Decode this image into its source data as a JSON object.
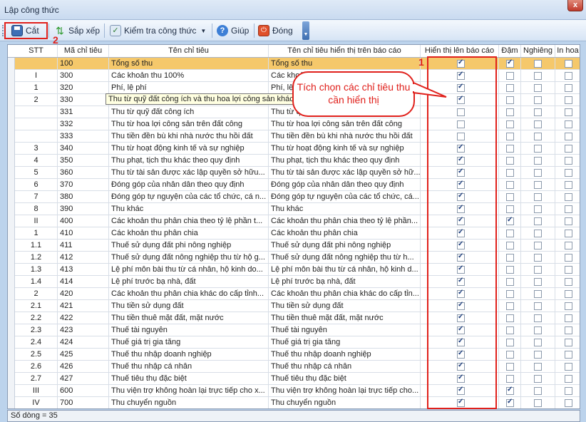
{
  "window": {
    "title": "Lập công thức",
    "close_glyph": "x"
  },
  "toolbar": {
    "cut_label": "Cắt",
    "sort_label": "Sắp xếp",
    "check_label": "Kiểm tra công thức",
    "help_label": "Giúp",
    "close_label": "Đóng"
  },
  "annotations": {
    "marker_1": "1",
    "marker_2": "2",
    "callout": "Tích chọn các chỉ tiêu thu cần hiển thị"
  },
  "tooltip": {
    "text": "Thu từ quỹ đất công ích và thu hoa lợi công sản khác đất công"
  },
  "columns": {
    "stt": "STT",
    "code": "Mã chỉ tiêu",
    "name": "Tên chỉ tiêu",
    "report_name": "Tên chỉ tiêu hiển thị trên báo cáo",
    "show": "Hiển thị lên báo cáo",
    "bold": "Đậm",
    "italic": "Nghiêng",
    "upper": "In hoa"
  },
  "rows": [
    {
      "stt": "",
      "code": "100",
      "name": "Tổng số thu",
      "report": "Tổng số thu",
      "show": true,
      "bold": true,
      "italic": false,
      "upper": false
    },
    {
      "stt": "I",
      "code": "300",
      "name": "Các khoản thu 100%",
      "report": "Các khoả",
      "show": true,
      "bold": false,
      "italic": false,
      "upper": false
    },
    {
      "stt": "1",
      "code": "320",
      "name": "Phí, lệ phí",
      "report": "Phí, lệ ph",
      "show": true,
      "bold": false,
      "italic": false,
      "upper": false
    },
    {
      "stt": "2",
      "code": "330",
      "name": "",
      "report": "",
      "show": true,
      "bold": false,
      "italic": false,
      "upper": false
    },
    {
      "stt": "",
      "code": "331",
      "name": "Thu từ quỹ đất công ích",
      "report": "Thu từ q",
      "show": false,
      "bold": false,
      "italic": false,
      "upper": false
    },
    {
      "stt": "",
      "code": "332",
      "name": "Thu từ hoa lợi công sản trên đất công",
      "report": "Thu từ hoa lợi công sản trên đất công",
      "show": false,
      "bold": false,
      "italic": false,
      "upper": false
    },
    {
      "stt": "",
      "code": "333",
      "name": "Thu tiền đền bù khi nhà nước thu hồi đất",
      "report": "Thu tiền đền bù khi nhà nước thu hồi đất",
      "show": false,
      "bold": false,
      "italic": false,
      "upper": false
    },
    {
      "stt": "3",
      "code": "340",
      "name": "Thu từ hoạt động kinh tế và sự nghiệp",
      "report": "Thu từ hoạt động kinh tế và sự nghiệp",
      "show": true,
      "bold": false,
      "italic": false,
      "upper": false
    },
    {
      "stt": "4",
      "code": "350",
      "name": "Thu phạt, tịch thu khác theo quy định",
      "report": "Thu phạt, tịch thu khác theo quy định",
      "show": true,
      "bold": false,
      "italic": false,
      "upper": false
    },
    {
      "stt": "5",
      "code": "360",
      "name": "Thu từ tài sản được xác lập quyền sở hữu...",
      "report": "Thu từ tài sản được xác lập quyền sở hữ...",
      "show": true,
      "bold": false,
      "italic": false,
      "upper": false
    },
    {
      "stt": "6",
      "code": "370",
      "name": "Đóng góp của nhân dân theo quy định",
      "report": "Đóng góp của nhân dân theo quy định",
      "show": true,
      "bold": false,
      "italic": false,
      "upper": false
    },
    {
      "stt": "7",
      "code": "380",
      "name": "Đóng góp tự nguyện của các tổ chức, cá n...",
      "report": "Đóng góp tự nguyện của các tổ chức, cá...",
      "show": true,
      "bold": false,
      "italic": false,
      "upper": false
    },
    {
      "stt": "8",
      "code": "390",
      "name": "Thu khác",
      "report": "Thu khác",
      "show": true,
      "bold": false,
      "italic": false,
      "upper": false
    },
    {
      "stt": "II",
      "code": "400",
      "name": "Các khoản thu phân chia theo tỷ lệ phần t...",
      "report": "Các khoản thu phân chia theo tỷ lệ phần...",
      "show": true,
      "bold": true,
      "italic": false,
      "upper": false
    },
    {
      "stt": "1",
      "code": "410",
      "name": "Các khoản thu phân chia",
      "report": "Các khoản thu phân chia",
      "show": true,
      "bold": false,
      "italic": false,
      "upper": false
    },
    {
      "stt": "1.1",
      "code": "411",
      "name": "Thuế sử dụng đất phi nông nghiệp",
      "report": "Thuế sử dụng đất phi nông nghiệp",
      "show": true,
      "bold": false,
      "italic": false,
      "upper": false
    },
    {
      "stt": "1.2",
      "code": "412",
      "name": "Thuế sử dụng đất nông nghiệp thu từ hộ g...",
      "report": "Thuế sử dụng đất nông nghiệp thu từ h...",
      "show": true,
      "bold": false,
      "italic": false,
      "upper": false
    },
    {
      "stt": "1.3",
      "code": "413",
      "name": "Lệ phí môn bài thu từ cá nhân, hộ kinh do...",
      "report": "Lệ phí môn bài thu từ cá nhân, hộ kinh d...",
      "show": true,
      "bold": false,
      "italic": false,
      "upper": false
    },
    {
      "stt": "1.4",
      "code": "414",
      "name": "Lệ phí trước bạ nhà, đất",
      "report": "Lệ phí trước bạ nhà, đất",
      "show": true,
      "bold": false,
      "italic": false,
      "upper": false
    },
    {
      "stt": "2",
      "code": "420",
      "name": "Các khoản thu phân chia khác do cấp tỉnh...",
      "report": "Các khoản thu phân chia khác do cấp tỉn...",
      "show": true,
      "bold": false,
      "italic": false,
      "upper": false
    },
    {
      "stt": "2.1",
      "code": "421",
      "name": "Thu tiền sử dụng đất",
      "report": "Thu tiền sử dụng đất",
      "show": true,
      "bold": false,
      "italic": false,
      "upper": false
    },
    {
      "stt": "2.2",
      "code": "422",
      "name": "Thu tiền thuê mặt đất, mặt nước",
      "report": "Thu tiền thuê mặt đất, mặt nước",
      "show": true,
      "bold": false,
      "italic": false,
      "upper": false
    },
    {
      "stt": "2.3",
      "code": "423",
      "name": "Thuế tài nguyên",
      "report": "Thuế tài nguyên",
      "show": true,
      "bold": false,
      "italic": false,
      "upper": false
    },
    {
      "stt": "2.4",
      "code": "424",
      "name": "Thuế giá trị gia tăng",
      "report": "Thuế giá trị gia tăng",
      "show": true,
      "bold": false,
      "italic": false,
      "upper": false
    },
    {
      "stt": "2.5",
      "code": "425",
      "name": "Thuế thu nhập doanh nghiệp",
      "report": "Thuế thu nhập doanh nghiệp",
      "show": true,
      "bold": false,
      "italic": false,
      "upper": false
    },
    {
      "stt": "2.6",
      "code": "426",
      "name": "Thuế thu nhập cá nhân",
      "report": "Thuế thu nhập cá nhân",
      "show": true,
      "bold": false,
      "italic": false,
      "upper": false
    },
    {
      "stt": "2.7",
      "code": "427",
      "name": "Thuế tiêu thụ đặc biệt",
      "report": "Thuế tiêu thụ đặc biệt",
      "show": true,
      "bold": false,
      "italic": false,
      "upper": false
    },
    {
      "stt": "III",
      "code": "600",
      "name": "Thu viện trợ không hoàn lại trực tiếp cho x...",
      "report": "Thu viện trợ không hoàn lại trực tiếp cho...",
      "show": true,
      "bold": true,
      "italic": false,
      "upper": false
    },
    {
      "stt": "IV",
      "code": "700",
      "name": "Thu chuyển nguồn",
      "report": "Thu chuyển nguồn",
      "show": true,
      "bold": true,
      "italic": false,
      "upper": false
    }
  ],
  "status": {
    "row_count": "Số dòng = 35"
  },
  "colors": {
    "accent_red": "#e0201b",
    "selected_row": "#f5c86b",
    "toolbar_blue": "#d6e4f5"
  }
}
